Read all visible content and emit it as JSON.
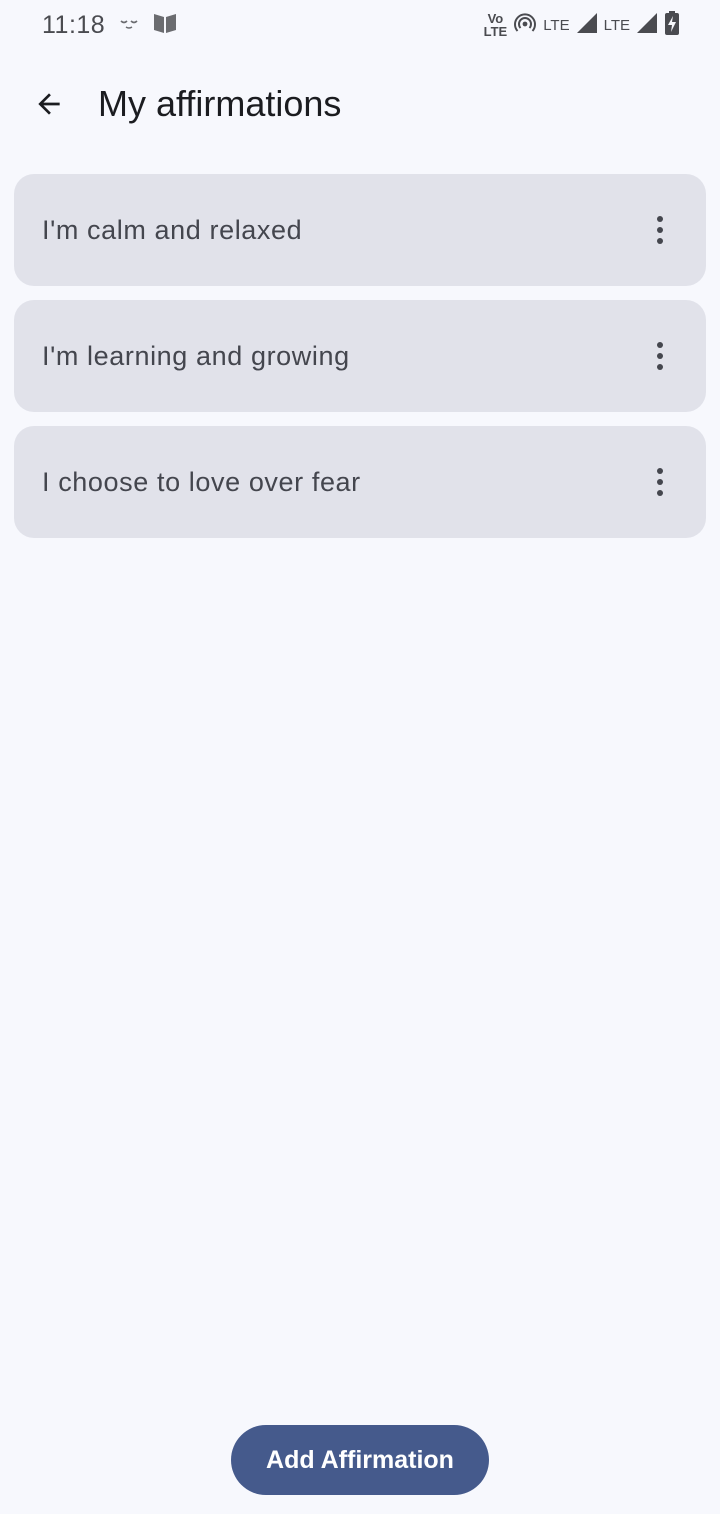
{
  "status_bar": {
    "time": "11:18",
    "volte_top": "Vo",
    "volte_bottom": "LTE",
    "lte1": "LTE",
    "lte2": "LTE",
    "icons": [
      "face-icon",
      "book-icon",
      "volte-icon",
      "hotspot-icon",
      "signal-icon",
      "signal-icon",
      "battery-charging-icon"
    ]
  },
  "app_bar": {
    "back_icon": "arrow-back-icon",
    "title": "My affirmations"
  },
  "affirmations": [
    {
      "text": "I'm calm and relaxed",
      "menu_icon": "more-vert-icon"
    },
    {
      "text": "I'm learning and growing",
      "menu_icon": "more-vert-icon"
    },
    {
      "text": "I choose to love over fear",
      "menu_icon": "more-vert-icon"
    }
  ],
  "add_button": {
    "label": "Add Affirmation"
  },
  "colors": {
    "background": "#f7f8fd",
    "card": "#e1e2ea",
    "primary": "#455a8c",
    "text": "#44464e"
  }
}
